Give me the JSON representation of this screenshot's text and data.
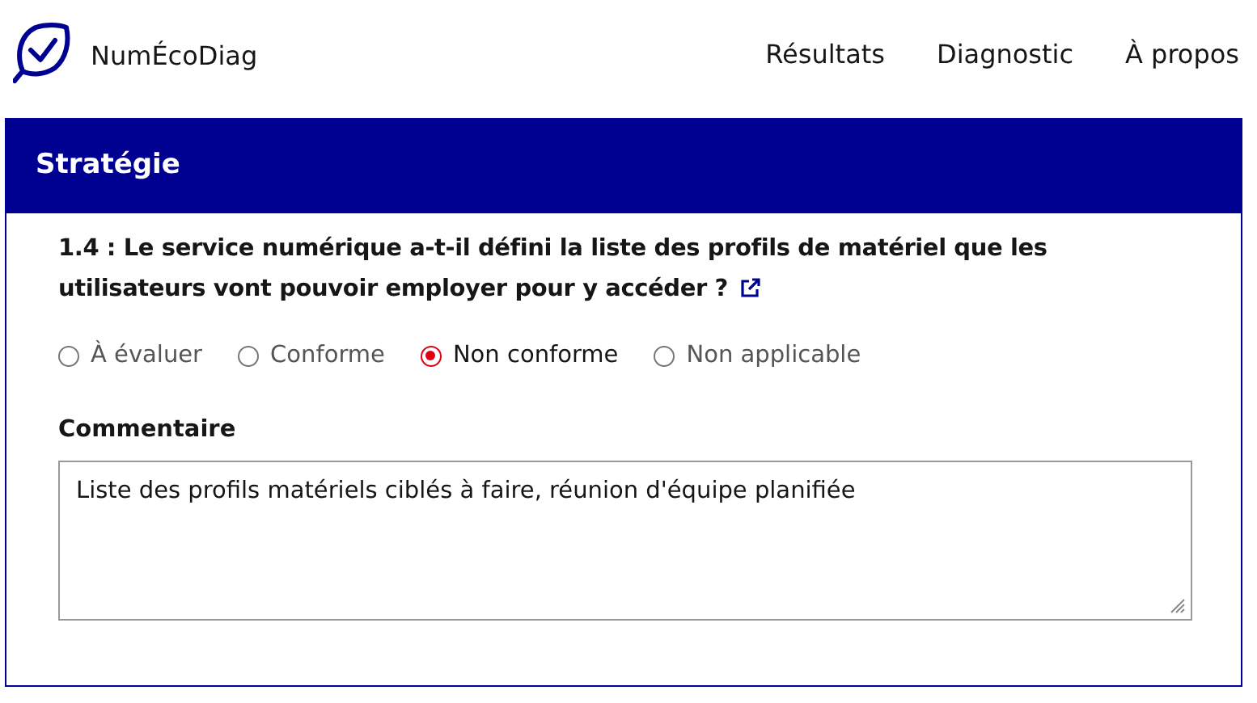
{
  "header": {
    "brand": "NumÉcoDiag",
    "nav": [
      {
        "label": "Résultats"
      },
      {
        "label": "Diagnostic"
      },
      {
        "label": "À propos"
      }
    ]
  },
  "section": {
    "title": "Stratégie",
    "question": "1.4 : Le service numérique a-t-il défini la liste des profils de matériel que les utilisateurs vont pouvoir employer pour y accéder ?",
    "options": [
      {
        "label": "À évaluer",
        "selected": false
      },
      {
        "label": "Conforme",
        "selected": false
      },
      {
        "label": "Non conforme",
        "selected": true
      },
      {
        "label": "Non applicable",
        "selected": false
      }
    ],
    "comment": {
      "label": "Commentaire",
      "value": "Liste des profils matériels ciblés à faire, réunion d'équipe planifiée"
    }
  }
}
